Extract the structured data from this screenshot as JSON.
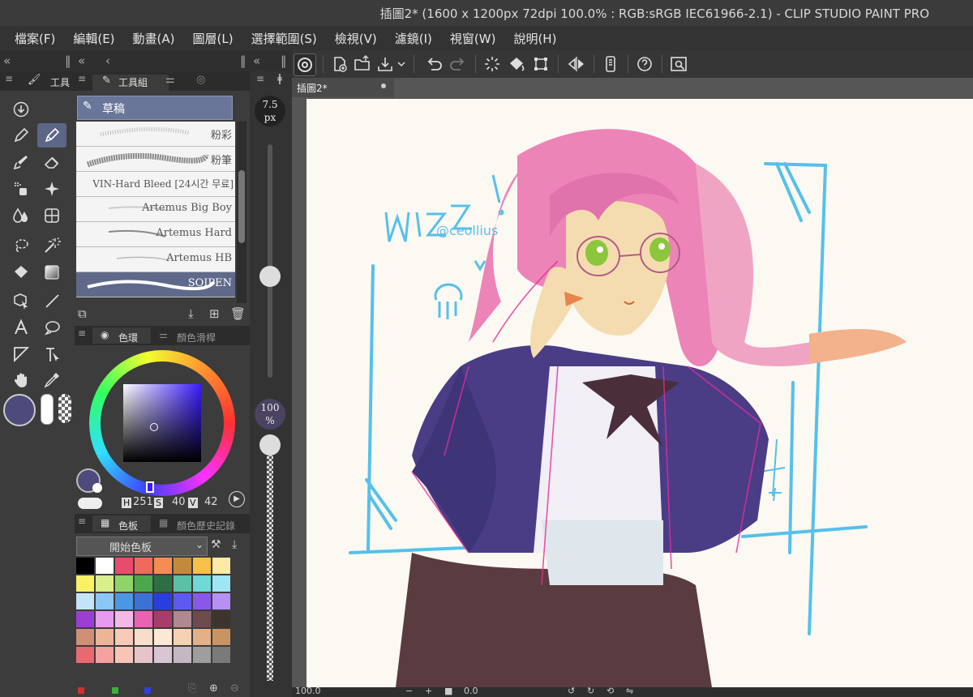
{
  "window": {
    "title": "插圖2* (1600 x 1200px 72dpi 100.0% : RGB:sRGB IEC61966-2.1)  - CLIP STUDIO PAINT PRO"
  },
  "menu": [
    "檔案(F)",
    "編輯(E)",
    "動畫(A)",
    "圖層(L)",
    "選擇範圍(S)",
    "檢視(V)",
    "濾鏡(I)",
    "視窗(W)",
    "說明(H)"
  ],
  "tool_panel": {
    "tab": "工具"
  },
  "subtool_panel": {
    "tab": "工具組",
    "group": "草稿",
    "brushes": [
      "粉彩",
      "粉筆",
      "VIN-Hard Bleed [24시간 무료]",
      "Artemus Big Boy",
      "Artemus Hard",
      "Artemus HB",
      "SOIPEN"
    ],
    "selected_brush": "SOIPEN"
  },
  "color_panel": {
    "tab_wheel": "色環",
    "tab_slider": "顏色滑桿",
    "h": "251",
    "s": "40",
    "v": "42",
    "h_label": "H",
    "s_label": "S",
    "v_label": "V",
    "main_color": "#4e4a7c"
  },
  "palette_panel": {
    "tab_palette": "色板",
    "tab_history": "顏色歷史記錄",
    "selected": "開始色板",
    "colors": [
      "#000000",
      "#ffffff",
      "#e84c6c",
      "#f06a5c",
      "#f58c52",
      "#c48a3c",
      "#f7c048",
      "#fbe9a8",
      "#faf264",
      "#d8f08c",
      "#8ed468",
      "#4aa84c",
      "#2e6e44",
      "#5cc0a4",
      "#6ed8d6",
      "#9ee6f4",
      "#c2e4fa",
      "#8cc6f4",
      "#4a98e4",
      "#3a72d8",
      "#2a3ee0",
      "#5c5af0",
      "#8a58e8",
      "#b690f4",
      "#9a3ed4",
      "#e69af0",
      "#f4b8e8",
      "#ea62b2",
      "#aa3c6c",
      "#b08890",
      "#6e4c4c",
      "#3e342c",
      "#d08e74",
      "#eeb49a",
      "#f6cab6",
      "#f8dccc",
      "#fce8d4",
      "#f4d2b2",
      "#e4b088",
      "#c89464",
      "#e86a70",
      "#f4a2a0",
      "#f8c4b8",
      "#e6c4c8",
      "#d8c6d6",
      "#c6b8c2",
      "#9e9e9e",
      "#7a7a7a"
    ]
  },
  "size_bar": {
    "size": "7.5",
    "unit": "px",
    "opacity": "100",
    "opacity_unit": "%"
  },
  "canvas": {
    "doc_tab": "插圖2*",
    "signature_text": "@ceollius"
  },
  "status": {
    "zoom": "100.0",
    "angle": "0.0"
  }
}
